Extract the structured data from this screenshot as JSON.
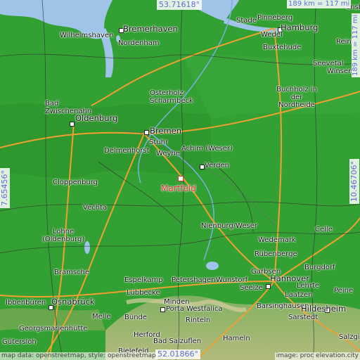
{
  "map": {
    "target_city": "Martfeld",
    "coords": {
      "north": "53.71618°",
      "south": "52.01866°",
      "west": "7.65456°",
      "east": "10.46706°"
    },
    "scale": {
      "top": "189 km = 117 mi",
      "right": "189 km = 117 mi"
    },
    "attribution_left": "map data: openstreetmap, style: openstreetmap",
    "attribution_right": "image: proc elevation.city",
    "cities": [
      "Bremerhaven",
      "Nordenham",
      "Wilhelmshaven",
      "Stade",
      "Pinneberg",
      "Hamburg",
      "Wedel",
      "Buxtehude",
      "Seevetal",
      "Winsen",
      "Reinb",
      "Osterholz-Scharmbeck",
      "Buchholz in der Nordheide",
      "Bad Zwischenahn",
      "Oldenburg",
      "Bremen",
      "Stuhr",
      "Delmenhorst",
      "Weyhe",
      "Achim (Weser)",
      "Verden",
      "Cloppenburg",
      "Vechta",
      "Lohne (Oldenburg)",
      "Nienburg/Weser",
      "Celle",
      "Wedemark",
      "Rübenberge",
      "Burgdorf",
      "Garbsen",
      "Hannover",
      "Lehrte",
      "Seelze",
      "Laatzen",
      "Peine",
      "Bramsche",
      "Espelkamp",
      "Petershagen",
      "Wunstorf",
      "Barsinghausen",
      "Ibbenbüren",
      "Osnabrück",
      "Lübbecke",
      "Minden",
      "Porta Westfalica",
      "Georgsmarienhütte",
      "Melle",
      "Bünde",
      "Rinteln",
      "Herford",
      "Bad Salzuflen",
      "Hameln",
      "Hildesheim",
      "Bielefeld",
      "Gütersloh",
      "Salzgitter",
      "Sarstedt",
      "ensb"
    ]
  }
}
